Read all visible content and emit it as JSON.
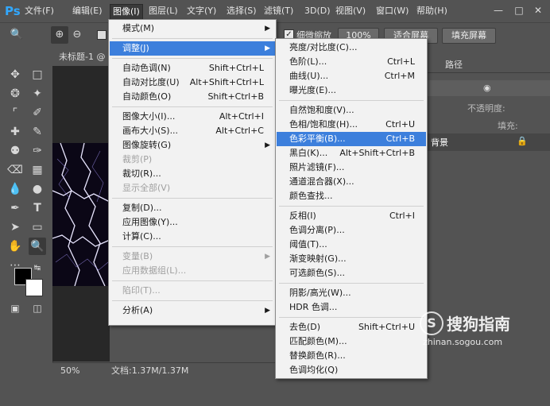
{
  "app": {
    "logo": "Ps"
  },
  "menubar": {
    "items": [
      "文件(F)",
      "编辑(E)",
      "图像(I)",
      "图层(L)",
      "文字(Y)",
      "选择(S)",
      "滤镜(T)",
      "3D(D)",
      "视图(V)",
      "窗口(W)",
      "帮助(H)"
    ],
    "active_index": 2
  },
  "options": {
    "checkbox_label": "细微缩放",
    "zoom_value": "100%",
    "fit_screen": "适合屏幕",
    "fill_screen": "填充屏幕"
  },
  "document": {
    "tab": "未标题-1 @",
    "zoom": "50%",
    "doc_info": "文档:1.37M/1.37M"
  },
  "image_menu": {
    "items": [
      {
        "label": "模式(M)",
        "shortcut": "",
        "submenu": true
      },
      {
        "sep": true
      },
      {
        "label": "调整(J)",
        "shortcut": "",
        "submenu": true,
        "highlight": true
      },
      {
        "sep": true
      },
      {
        "label": "自动色调(N)",
        "shortcut": "Shift+Ctrl+L"
      },
      {
        "label": "自动对比度(U)",
        "shortcut": "Alt+Shift+Ctrl+L"
      },
      {
        "label": "自动颜色(O)",
        "shortcut": "Shift+Ctrl+B"
      },
      {
        "sep": true
      },
      {
        "label": "图像大小(I)...",
        "shortcut": "Alt+Ctrl+I"
      },
      {
        "label": "画布大小(S)...",
        "shortcut": "Alt+Ctrl+C"
      },
      {
        "label": "图像旋转(G)",
        "shortcut": "",
        "submenu": true
      },
      {
        "label": "裁剪(P)",
        "shortcut": "",
        "disabled": true
      },
      {
        "label": "裁切(R)...",
        "shortcut": ""
      },
      {
        "label": "显示全部(V)",
        "shortcut": "",
        "disabled": true
      },
      {
        "sep": true
      },
      {
        "label": "复制(D)...",
        "shortcut": ""
      },
      {
        "label": "应用图像(Y)...",
        "shortcut": ""
      },
      {
        "label": "计算(C)...",
        "shortcut": ""
      },
      {
        "sep": true
      },
      {
        "label": "变量(B)",
        "shortcut": "",
        "submenu": true,
        "disabled": true
      },
      {
        "label": "应用数据组(L)...",
        "shortcut": "",
        "disabled": true
      },
      {
        "sep": true
      },
      {
        "label": "陷印(T)...",
        "shortcut": "",
        "disabled": true
      },
      {
        "sep": true
      },
      {
        "label": "分析(A)",
        "shortcut": "",
        "submenu": true
      }
    ]
  },
  "adjust_menu": {
    "items": [
      {
        "label": "亮度/对比度(C)...",
        "shortcut": ""
      },
      {
        "label": "色阶(L)...",
        "shortcut": "Ctrl+L"
      },
      {
        "label": "曲线(U)...",
        "shortcut": "Ctrl+M"
      },
      {
        "label": "曝光度(E)...",
        "shortcut": ""
      },
      {
        "sep": true
      },
      {
        "label": "自然饱和度(V)...",
        "shortcut": ""
      },
      {
        "label": "色相/饱和度(H)...",
        "shortcut": "Ctrl+U"
      },
      {
        "label": "色彩平衡(B)...",
        "shortcut": "Ctrl+B",
        "highlight": true
      },
      {
        "label": "黑白(K)...",
        "shortcut": "Alt+Shift+Ctrl+B"
      },
      {
        "label": "照片滤镜(F)...",
        "shortcut": ""
      },
      {
        "label": "通道混合器(X)...",
        "shortcut": ""
      },
      {
        "label": "颜色查找...",
        "shortcut": ""
      },
      {
        "sep": true
      },
      {
        "label": "反相(I)",
        "shortcut": "Ctrl+I"
      },
      {
        "label": "色调分离(P)...",
        "shortcut": ""
      },
      {
        "label": "阈值(T)...",
        "shortcut": ""
      },
      {
        "label": "渐变映射(G)...",
        "shortcut": ""
      },
      {
        "label": "可选颜色(S)...",
        "shortcut": ""
      },
      {
        "sep": true
      },
      {
        "label": "阴影/高光(W)...",
        "shortcut": ""
      },
      {
        "label": "HDR 色调...",
        "shortcut": ""
      },
      {
        "sep": true
      },
      {
        "label": "去色(D)",
        "shortcut": "Shift+Ctrl+U"
      },
      {
        "label": "匹配颜色(M)...",
        "shortcut": ""
      },
      {
        "label": "替换颜色(R)...",
        "shortcut": ""
      },
      {
        "label": "色调均化(Q)",
        "shortcut": ""
      }
    ]
  },
  "panels": {
    "tab_paths": "路径",
    "opacity_label": "不透明度:",
    "fill_label": "填充:",
    "layer_name": "背景"
  },
  "watermark": {
    "brand": "搜狗指南",
    "url": "zhinan.sogou.com"
  }
}
